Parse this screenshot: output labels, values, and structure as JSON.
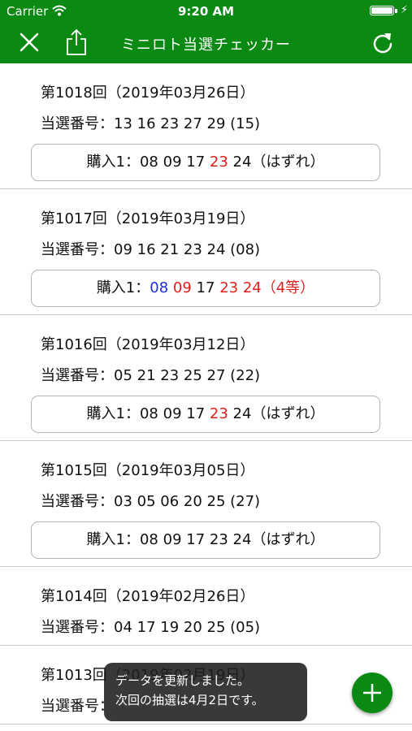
{
  "status_bar": {
    "carrier": "Carrier",
    "time": "9:20 AM"
  },
  "nav": {
    "title": "ミニロト当選チェッカー",
    "icons": [
      "close-icon",
      "share-icon",
      "refresh-icon"
    ]
  },
  "colors": {
    "brand_green": "#0a8a12",
    "hit_red": "#e0201c",
    "bonus_blue": "#1d2fd8"
  },
  "draws": [
    {
      "title": "第1018回（2019年03月26日）",
      "numbers": "当選番号：13 16 23 27 29 (15)",
      "purchase": {
        "prefix": "購入1：",
        "tokens": [
          {
            "text": "08",
            "hit": "none"
          },
          {
            "text": "09",
            "hit": "none"
          },
          {
            "text": "17",
            "hit": "none"
          },
          {
            "text": "23",
            "hit": "main"
          },
          {
            "text": "24",
            "hit": "none"
          }
        ],
        "result": "（はずれ）",
        "result_hit": false
      }
    },
    {
      "title": "第1017回（2019年03月19日）",
      "numbers": "当選番号：09 16 21 23 24 (08)",
      "purchase": {
        "prefix": "購入1：",
        "tokens": [
          {
            "text": "08",
            "hit": "bonus"
          },
          {
            "text": "09",
            "hit": "main"
          },
          {
            "text": "17",
            "hit": "none"
          },
          {
            "text": "23",
            "hit": "main"
          },
          {
            "text": "24",
            "hit": "main"
          }
        ],
        "result": "（4等）",
        "result_hit": true
      }
    },
    {
      "title": "第1016回（2019年03月12日）",
      "numbers": "当選番号：05 21 23 25 27 (22)",
      "purchase": {
        "prefix": "購入1：",
        "tokens": [
          {
            "text": "08",
            "hit": "none"
          },
          {
            "text": "09",
            "hit": "none"
          },
          {
            "text": "17",
            "hit": "none"
          },
          {
            "text": "23",
            "hit": "main"
          },
          {
            "text": "24",
            "hit": "none"
          }
        ],
        "result": "（はずれ）",
        "result_hit": false
      }
    },
    {
      "title": "第1015回（2019年03月05日）",
      "numbers": "当選番号：03 05 06 20 25 (27)",
      "purchase": {
        "prefix": "購入1：",
        "tokens": [
          {
            "text": "08",
            "hit": "none"
          },
          {
            "text": "09",
            "hit": "none"
          },
          {
            "text": "17",
            "hit": "none"
          },
          {
            "text": "23",
            "hit": "none"
          },
          {
            "text": "24",
            "hit": "none"
          }
        ],
        "result": "（はずれ）",
        "result_hit": false
      }
    },
    {
      "title": "第1014回（2019年02月26日）",
      "numbers": "当選番号：04 17 19 20 25 (05)",
      "purchase": null
    },
    {
      "title": "第1013回（2019年02月19日）",
      "numbers": "当選番号：",
      "purchase": null
    }
  ],
  "toast": {
    "line1": "データを更新しました。",
    "line2": "次回の抽選は4月2日です。"
  },
  "fab": {
    "icon": "plus-icon"
  }
}
